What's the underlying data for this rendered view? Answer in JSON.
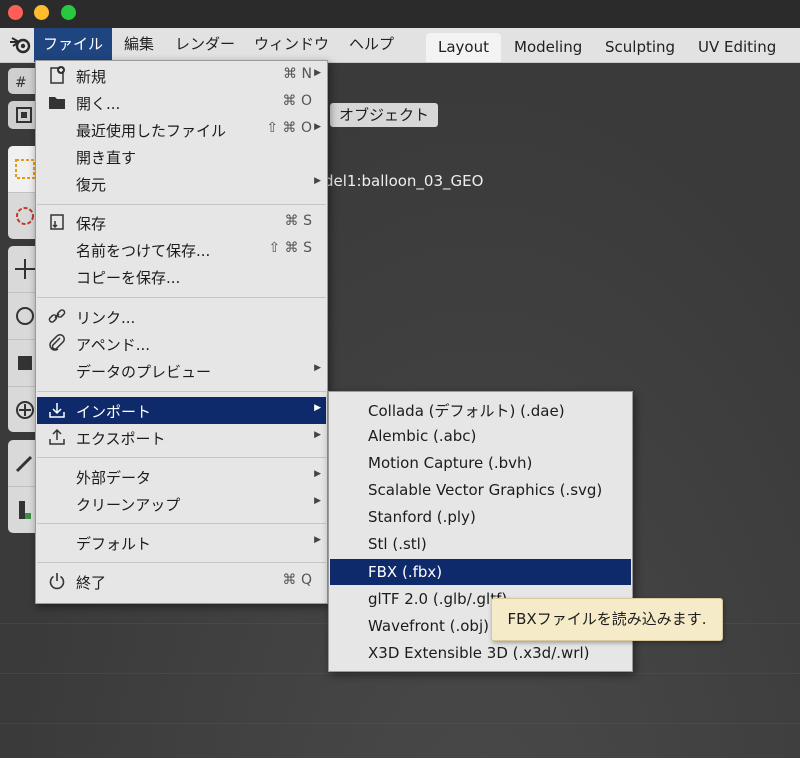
{
  "colors": {
    "menu_bg": "#e6e6e6",
    "highlight": "#0e2a6b",
    "tooltip_bg": "#f6ebc9",
    "traffic_close": "#ff5f57",
    "traffic_min": "#ffbd2e",
    "traffic_max": "#28c840"
  },
  "menubar": {
    "logo_icon": "blender-logo-icon",
    "items": [
      "ファイル",
      "編集",
      "レンダー",
      "ウィンドウ",
      "ヘルプ"
    ]
  },
  "workspace_tabs": [
    "Layout",
    "Modeling",
    "Sculpting",
    "UV Editing"
  ],
  "viewport": {
    "mode_button": "オブジェクト",
    "object_label": "del1:balloon_03_GEO"
  },
  "file_menu": {
    "items": [
      {
        "label": "新規",
        "shortcut": "⌘ N",
        "icon": "new-file-icon",
        "submenu": true
      },
      {
        "label": "開く...",
        "shortcut": "⌘ O",
        "icon": "folder-icon",
        "submenu": false
      },
      {
        "label": "最近使用したファイル",
        "shortcut": "⇧ ⌘ O",
        "icon": "",
        "submenu": true
      },
      {
        "label": "開き直す",
        "shortcut": "",
        "icon": "",
        "submenu": false
      },
      {
        "label": "復元",
        "shortcut": "",
        "icon": "",
        "submenu": true
      },
      {
        "label": "保存",
        "shortcut": "⌘ S",
        "icon": "save-icon",
        "submenu": false
      },
      {
        "label": "名前をつけて保存...",
        "shortcut": "⇧ ⌘ S",
        "icon": "",
        "submenu": false
      },
      {
        "label": "コピーを保存...",
        "shortcut": "",
        "icon": "",
        "submenu": false
      },
      {
        "label": "リンク...",
        "shortcut": "",
        "icon": "link-icon",
        "submenu": false
      },
      {
        "label": "アペンド...",
        "shortcut": "",
        "icon": "paperclip-icon",
        "submenu": false
      },
      {
        "label": "データのプレビュー",
        "shortcut": "",
        "icon": "",
        "submenu": true
      },
      {
        "label": "インポート",
        "shortcut": "",
        "icon": "import-icon",
        "submenu": true
      },
      {
        "label": "エクスポート",
        "shortcut": "",
        "icon": "export-icon",
        "submenu": true
      },
      {
        "label": "外部データ",
        "shortcut": "",
        "icon": "",
        "submenu": true
      },
      {
        "label": "クリーンアップ",
        "shortcut": "",
        "icon": "",
        "submenu": true
      },
      {
        "label": "デフォルト",
        "shortcut": "",
        "icon": "",
        "submenu": true
      },
      {
        "label": "終了",
        "shortcut": "⌘ Q",
        "icon": "power-icon",
        "submenu": false
      }
    ]
  },
  "import_menu": {
    "items": [
      "Collada (デフォルト) (.dae)",
      "Alembic (.abc)",
      "Motion Capture (.bvh)",
      "Scalable Vector Graphics (.svg)",
      "Stanford (.ply)",
      "Stl (.stl)",
      "FBX (.fbx)",
      "glTF 2.0 (.glb/.gltf)",
      "Wavefront (.obj)",
      "X3D Extensible 3D (.x3d/.wrl)"
    ],
    "selected": "FBX (.fbx)"
  },
  "tooltip": "FBXファイルを読み込みます."
}
